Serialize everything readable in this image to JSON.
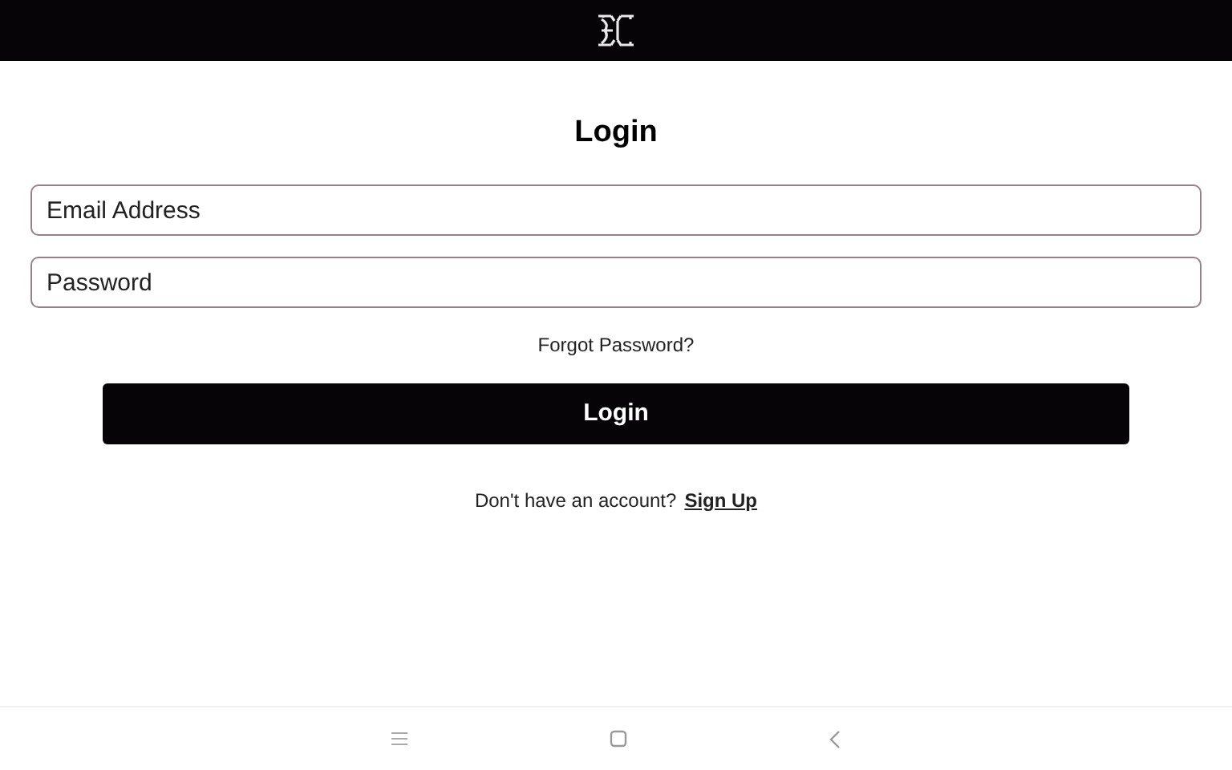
{
  "title": "Login",
  "fields": [
    {
      "placeholder": "Email Address"
    },
    {
      "placeholder": "Password"
    }
  ],
  "forgot_link": "Forgot Password?",
  "login_button": "Login",
  "signup_prompt": "Don't have an account?",
  "signup_link": "Sign Up"
}
